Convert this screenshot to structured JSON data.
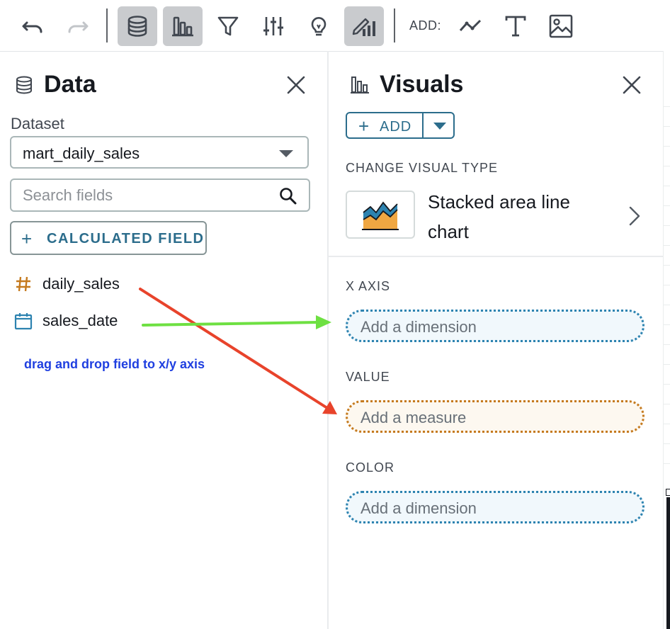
{
  "toolbar": {
    "add_label": "ADD:",
    "buttons": [
      {
        "name": "undo-icon",
        "active": false
      },
      {
        "name": "redo-icon",
        "active": false
      },
      {
        "name": "data-icon",
        "active": true
      },
      {
        "name": "visuals-icon",
        "active": true
      },
      {
        "name": "filter-icon",
        "active": false
      },
      {
        "name": "parameters-icon",
        "active": false
      },
      {
        "name": "insights-icon",
        "active": false
      },
      {
        "name": "format-visual-icon",
        "active": true
      },
      {
        "name": "add-line-icon",
        "active": false
      },
      {
        "name": "add-text-icon",
        "active": false
      },
      {
        "name": "add-image-icon",
        "active": false
      }
    ]
  },
  "data_panel": {
    "title": "Data",
    "dataset_label": "Dataset",
    "dataset_value": "mart_daily_sales",
    "search_placeholder": "Search fields",
    "calculated_field_label": "CALCULATED FIELD",
    "fields": [
      {
        "name": "daily_sales",
        "type": "measure",
        "icon": "hash-icon",
        "color": "#c57a1e"
      },
      {
        "name": "sales_date",
        "type": "dimension",
        "icon": "calendar-icon",
        "color": "#2d83b0"
      }
    ],
    "annotation": "drag and drop field to x/y axis"
  },
  "visuals_panel": {
    "title": "Visuals",
    "add_label": "ADD",
    "change_type_label": "CHANGE VISUAL TYPE",
    "visual_type": "Stacked area line chart",
    "x_axis_label": "X AXIS",
    "x_axis_placeholder": "Add a dimension",
    "value_label": "VALUE",
    "value_placeholder": "Add a measure",
    "color_label": "COLOR",
    "color_placeholder": "Add a dimension"
  },
  "colors": {
    "accent": "#2c6d8c",
    "dimension": "#2d83b0",
    "measure": "#c57a1e",
    "arrow_red": "#e8432b",
    "arrow_green": "#6ee042",
    "annotation_text": "#1f3fe0"
  }
}
